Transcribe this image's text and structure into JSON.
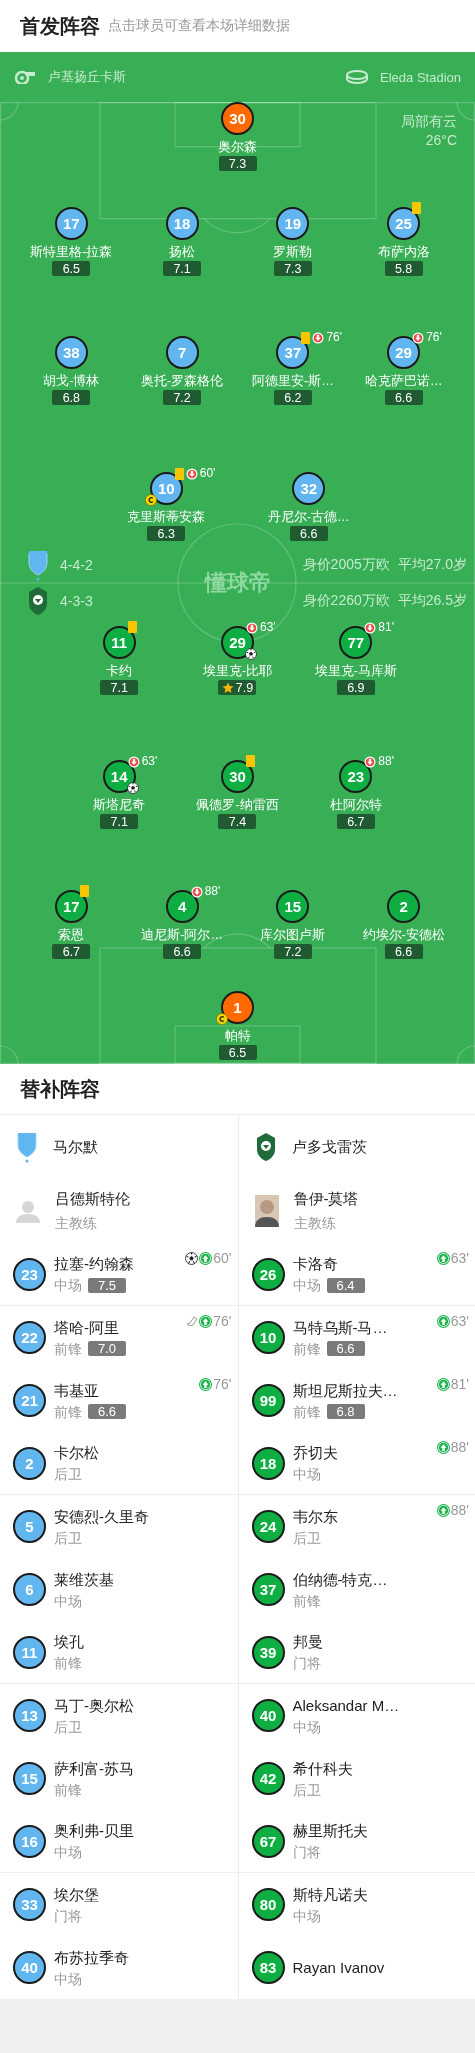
{
  "header": {
    "title": "首发阵容",
    "subtitle": "点击球员可查看本场详细数据"
  },
  "pitch": {
    "referee": "卢基扬丘卡斯",
    "stadium": "Eleda Stadion",
    "weather": {
      "condition": "局部有云",
      "temperature": "26°C"
    },
    "center_logo": "懂球帝",
    "home": {
      "color": "#62b6ef",
      "formation": "4-4-2",
      "market_value": "身价2005万欧",
      "average_age": "平均27.0岁",
      "lines": [
        [
          {
            "number": "30",
            "name": "奥尔森",
            "rating": "7.3",
            "color": "#ff6a00"
          }
        ],
        [
          {
            "number": "17",
            "name": "斯特里格-拉森",
            "rating": "6.5"
          },
          {
            "number": "18",
            "name": "扬松",
            "rating": "7.1"
          },
          {
            "number": "19",
            "name": "罗斯勒",
            "rating": "7.3"
          },
          {
            "number": "25",
            "name": "布萨内洛",
            "rating": "5.8",
            "events": [
              {
                "kind": "yellow_card"
              }
            ]
          }
        ],
        [
          {
            "number": "38",
            "name": "胡戈-博林",
            "rating": "6.8"
          },
          {
            "number": "7",
            "name": "奥托-罗森格伦",
            "rating": "7.2"
          },
          {
            "number": "37",
            "name": "阿德里安-斯…",
            "rating": "6.2",
            "events": [
              {
                "kind": "yellow_card"
              },
              {
                "kind": "sub_off",
                "minute": "76'"
              }
            ]
          },
          {
            "number": "29",
            "name": "哈克萨巴诺…",
            "rating": "6.6",
            "events": [
              {
                "kind": "sub_off",
                "minute": "76'"
              }
            ]
          }
        ],
        [
          {
            "number": "10",
            "name": "克里斯蒂安森",
            "rating": "6.3",
            "events": [
              {
                "kind": "yellow_card"
              },
              {
                "kind": "sub_off",
                "minute": "60'"
              },
              {
                "kind": "captain"
              }
            ]
          },
          {
            "number": "32",
            "name": "丹尼尔-古德…",
            "rating": "6.6"
          }
        ]
      ]
    },
    "away": {
      "color": "#0fae43",
      "formation": "4-3-3",
      "market_value": "身价2260万欧",
      "average_age": "平均26.5岁",
      "lines": [
        [
          {
            "number": "11",
            "name": "卡约",
            "rating": "7.1",
            "events": [
              {
                "kind": "yellow_card"
              }
            ]
          },
          {
            "number": "29",
            "name": "埃里克-比耶",
            "rating": "7.9",
            "events": [
              {
                "kind": "sub_off",
                "minute": "63'"
              },
              {
                "kind": "goal"
              },
              {
                "kind": "best_player"
              }
            ]
          },
          {
            "number": "77",
            "name": "埃里克-马库斯",
            "rating": "6.9",
            "events": [
              {
                "kind": "sub_off",
                "minute": "81'"
              }
            ]
          }
        ],
        [
          {
            "number": "14",
            "name": "斯塔尼奇",
            "rating": "7.1",
            "events": [
              {
                "kind": "sub_off",
                "minute": "63'"
              },
              {
                "kind": "goal"
              }
            ]
          },
          {
            "number": "30",
            "name": "佩德罗-纳雷西",
            "rating": "7.4",
            "events": [
              {
                "kind": "yellow_card"
              }
            ]
          },
          {
            "number": "23",
            "name": "杜阿尔特",
            "rating": "6.7",
            "events": [
              {
                "kind": "sub_off",
                "minute": "88'"
              }
            ]
          }
        ],
        [
          {
            "number": "17",
            "name": "索恩",
            "rating": "6.7",
            "events": [
              {
                "kind": "yellow_card"
              }
            ]
          },
          {
            "number": "4",
            "name": "迪尼斯-阿尔…",
            "rating": "6.6",
            "events": [
              {
                "kind": "sub_off",
                "minute": "88'"
              }
            ]
          },
          {
            "number": "15",
            "name": "库尔图卢斯",
            "rating": "7.2"
          },
          {
            "number": "2",
            "name": "约埃尔-安德松",
            "rating": "6.6"
          }
        ],
        [
          {
            "number": "1",
            "name": "帕特",
            "rating": "6.5",
            "color": "#ff6a00",
            "events": [
              {
                "kind": "captain"
              }
            ]
          }
        ]
      ]
    }
  },
  "substitutes": {
    "title": "替补阵容",
    "teams": [
      {
        "name": "马尔默",
        "color": "#62b6ef",
        "coach": {
          "name": "吕德斯特伦",
          "role": "主教练",
          "photo": false
        },
        "players": [
          {
            "number": "23",
            "name": "拉塞-约翰森",
            "position": "中场",
            "rating": "7.5",
            "events": [
              {
                "kind": "goal"
              },
              {
                "kind": "sub_on",
                "minute": "60'"
              }
            ]
          },
          {
            "number": "22",
            "name": "塔哈-阿里",
            "position": "前锋",
            "rating": "7.0",
            "events": [
              {
                "kind": "assist"
              },
              {
                "kind": "sub_on",
                "minute": "76'"
              }
            ]
          },
          {
            "number": "21",
            "name": "韦基亚",
            "position": "前锋",
            "rating": "6.6",
            "events": [
              {
                "kind": "sub_on",
                "minute": "76'"
              }
            ]
          },
          {
            "number": "2",
            "name": "卡尔松",
            "position": "后卫"
          },
          {
            "number": "5",
            "name": "安德烈-久里奇",
            "position": "后卫"
          },
          {
            "number": "6",
            "name": "莱维茨基",
            "position": "中场"
          },
          {
            "number": "11",
            "name": "埃孔",
            "position": "前锋"
          },
          {
            "number": "13",
            "name": "马丁-奥尔松",
            "position": "后卫"
          },
          {
            "number": "15",
            "name": "萨利富-苏马",
            "position": "前锋"
          },
          {
            "number": "16",
            "name": "奥利弗-贝里",
            "position": "中场"
          },
          {
            "number": "33",
            "name": "埃尔堡",
            "position": "门将"
          },
          {
            "number": "40",
            "name": "布苏拉季奇",
            "position": "中场"
          }
        ]
      },
      {
        "name": "卢多戈雷茨",
        "color": "#0fae43",
        "coach": {
          "name": "鲁伊-莫塔",
          "role": "主教练",
          "photo": true
        },
        "players": [
          {
            "number": "26",
            "name": "卡洛奇",
            "position": "中场",
            "rating": "6.4",
            "events": [
              {
                "kind": "sub_on",
                "minute": "63'"
              }
            ]
          },
          {
            "number": "10",
            "name": "马特乌斯-马…",
            "position": "前锋",
            "rating": "6.6",
            "events": [
              {
                "kind": "sub_on",
                "minute": "63'"
              }
            ]
          },
          {
            "number": "99",
            "name": "斯坦尼斯拉夫…",
            "position": "前锋",
            "rating": "6.8",
            "events": [
              {
                "kind": "sub_on",
                "minute": "81'"
              }
            ]
          },
          {
            "number": "18",
            "name": "乔切夫",
            "position": "中场",
            "events": [
              {
                "kind": "sub_on",
                "minute": "88'"
              }
            ]
          },
          {
            "number": "24",
            "name": "韦尔东",
            "position": "后卫",
            "events": [
              {
                "kind": "sub_on",
                "minute": "88'"
              }
            ]
          },
          {
            "number": "37",
            "name": "伯纳德-特克…",
            "position": "前锋"
          },
          {
            "number": "39",
            "name": "邦曼",
            "position": "门将"
          },
          {
            "number": "40",
            "name": "Aleksandar M…",
            "position": "中场"
          },
          {
            "number": "42",
            "name": "希什科夫",
            "position": "后卫"
          },
          {
            "number": "67",
            "name": "赫里斯托夫",
            "position": "门将"
          },
          {
            "number": "80",
            "name": "斯特凡诺夫",
            "position": "中场"
          },
          {
            "number": "83",
            "name": "Rayan Ivanov"
          }
        ]
      }
    ]
  }
}
